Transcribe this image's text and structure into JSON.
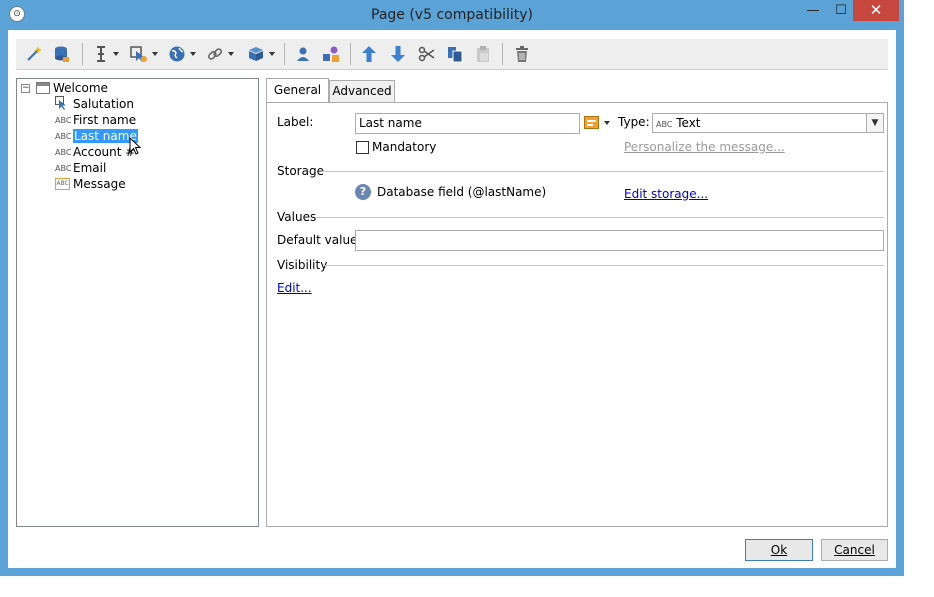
{
  "window": {
    "title": "Page (v5 compatibility)",
    "minimize": "—",
    "maximize": "☐",
    "close": "✕"
  },
  "toolbar": {
    "icons": [
      "wand-icon",
      "database-icon",
      "text-cursor-icon",
      "cursor-gear-icon",
      "globe-icon",
      "link-icon",
      "box-icon",
      "person-icon",
      "shapes-icon",
      "arrow-up-icon",
      "arrow-down-icon",
      "scissors-icon",
      "copy-icon",
      "paste-icon",
      "delete-icon"
    ]
  },
  "tree": {
    "root": "Welcome",
    "items": [
      {
        "label": "Salutation",
        "icon": "cursor-icon"
      },
      {
        "label": "First name",
        "icon": "abc-icon"
      },
      {
        "label": "Last name",
        "icon": "abc-icon",
        "selected": true
      },
      {
        "label": "Account #",
        "icon": "abc-icon"
      },
      {
        "label": "Email",
        "icon": "abc-icon"
      },
      {
        "label": "Message",
        "icon": "abc-box-icon"
      }
    ],
    "abc": "ABC",
    "abc_box": "ABC"
  },
  "tabs": {
    "general": "General",
    "advanced": "Advanced"
  },
  "general": {
    "label_caption": "Label:",
    "label_value": "Last name",
    "type_caption": "Type:",
    "type_prefix": "ABC",
    "type_value": "Text",
    "mandatory": "Mandatory",
    "personalize": "Personalize the message...",
    "storage_header": "Storage",
    "storage_field": "Database field (@lastName)",
    "edit_storage": "Edit storage...",
    "values_header": "Values",
    "default_caption": "Default value:",
    "default_value": "",
    "visibility_header": "Visibility",
    "visibility_edit": "Edit..."
  },
  "buttons": {
    "ok": "Ok",
    "cancel": "Cancel"
  }
}
